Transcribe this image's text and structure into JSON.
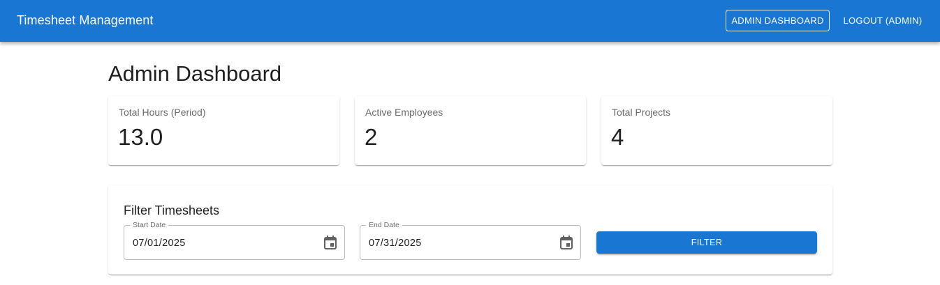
{
  "colors": {
    "primary": "#1976d2",
    "page_background": "#ffffff",
    "card_label": "#6b6b6b"
  },
  "appbar": {
    "title": "Timesheet Management",
    "nav": {
      "admin_dashboard": "ADMIN DASHBOARD",
      "logout": "LOGOUT (ADMIN)"
    }
  },
  "main": {
    "title": "Admin Dashboard",
    "stats": [
      {
        "label": "Total Hours (Period)",
        "value": "13.0"
      },
      {
        "label": "Active Employees",
        "value": "2"
      },
      {
        "label": "Total Projects",
        "value": "4"
      }
    ],
    "filter": {
      "title": "Filter Timesheets",
      "start_date": {
        "label": "Start Date",
        "value": "07/01/2025",
        "icon": "calendar-icon"
      },
      "end_date": {
        "label": "End Date",
        "value": "07/31/2025",
        "icon": "calendar-icon"
      },
      "button_label": "FILTER"
    }
  }
}
